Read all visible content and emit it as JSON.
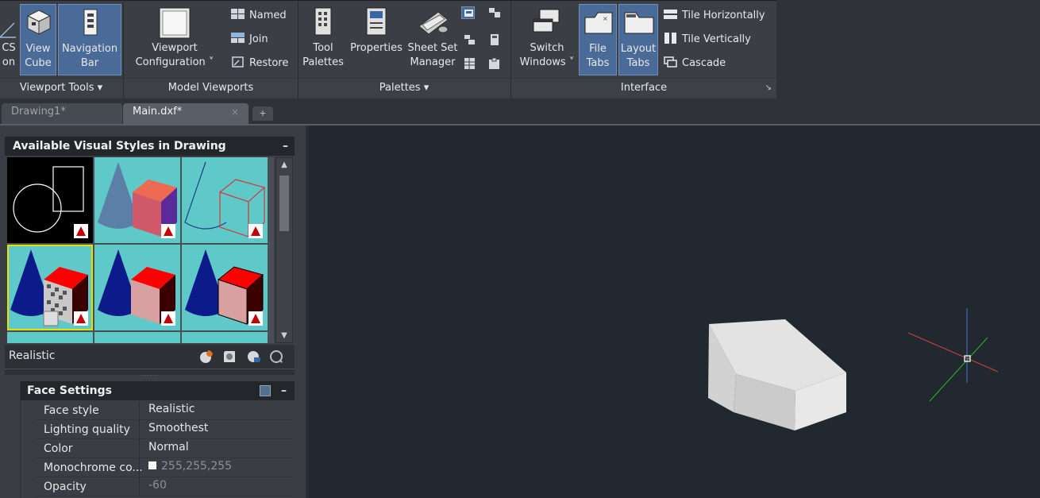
{
  "ribbon": {
    "viewport_tools": {
      "ucs_label_line1": "CS",
      "ucs_label_line2": "on",
      "viewcube_line1": "View",
      "viewcube_line2": "Cube",
      "navbar_line1": "Navigation",
      "navbar_line2": "Bar",
      "panel_label": "Viewport Tools ▾"
    },
    "model_viewports": {
      "config_line1": "Viewport",
      "config_line2": "Configuration ˅",
      "named": "Named",
      "join": "Join",
      "restore": "Restore",
      "panel_label": "Model Viewports"
    },
    "palettes": {
      "tool_line1": "Tool",
      "tool_line2": "Palettes",
      "properties": "Properties",
      "sheetset_line1": "Sheet Set",
      "sheetset_line2": "Manager",
      "panel_label": "Palettes ▾"
    },
    "interface": {
      "switch_line1": "Switch",
      "switch_line2": "Windows ˅",
      "filetabs_line1": "File",
      "filetabs_line2": "Tabs",
      "layouttabs_line1": "Layout",
      "layouttabs_line2": "Tabs",
      "tile_horizontally": "Tile Horizontally",
      "tile_vertically": "Tile Vertically",
      "cascade": "Cascade",
      "panel_label": "Interface",
      "launcher": "↘"
    }
  },
  "tabs": [
    {
      "label": "Drawing1*",
      "active": false
    },
    {
      "label": "Main.dxf*",
      "active": true,
      "close": "×"
    }
  ],
  "tab_plus": "+",
  "palette": {
    "title": "Available Visual Styles in Drawing",
    "minimize": "–",
    "selected_style": "Realistic",
    "grip": "......",
    "face_settings": {
      "header": "Face Settings",
      "minimize": "–",
      "rows": [
        {
          "key": "Face style",
          "value": "Realistic"
        },
        {
          "key": "Lighting quality",
          "value": "Smoothest"
        },
        {
          "key": "Color",
          "value": "Normal"
        },
        {
          "key": "Monochrome co...",
          "value": "255,255,255"
        },
        {
          "key": "Opacity",
          "value": "-60"
        }
      ]
    }
  },
  "colors": {
    "ribbon_bg": "#3b3f45",
    "active_button": "#4a6a98",
    "viewport_bg": "#212830",
    "thumb_bg": "#5fc9c9",
    "selection_outline": "#e4e000"
  }
}
